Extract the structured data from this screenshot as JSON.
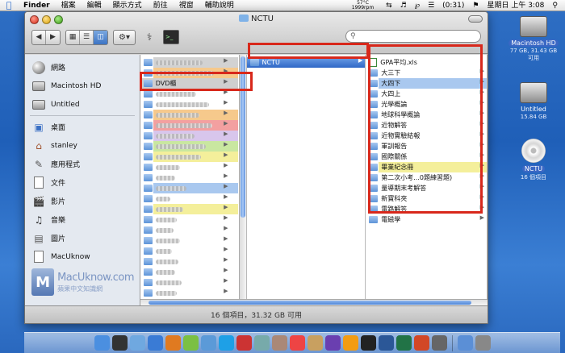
{
  "menubar": {
    "app": "Finder",
    "items": [
      "檔案",
      "編輯",
      "顯示方式",
      "前往",
      "視窗",
      "輔助說明"
    ],
    "temp": "57°C",
    "rpm": "1999rpm",
    "battery": "(0:31)",
    "clock": "星期日 上午 3:08"
  },
  "window": {
    "title": "NCTU",
    "search_placeholder": "",
    "status": "16 個項目，31.32 GB 可用"
  },
  "sidebar": {
    "devices": [
      {
        "label": "網路",
        "icon": "network-icon"
      },
      {
        "label": "Macintosh HD",
        "icon": "hard-drive-icon"
      },
      {
        "label": "Untitled",
        "icon": "drive-icon"
      }
    ],
    "places": [
      {
        "label": "桌面",
        "icon": "desktop-icon"
      },
      {
        "label": "stanley",
        "icon": "home-icon"
      },
      {
        "label": "應用程式",
        "icon": "applications-icon"
      },
      {
        "label": "文件",
        "icon": "documents-icon"
      },
      {
        "label": "影片",
        "icon": "movies-icon"
      },
      {
        "label": "音樂",
        "icon": "music-icon"
      },
      {
        "label": "圖片",
        "icon": "pictures-icon"
      },
      {
        "label": "MacUknow",
        "icon": "doc-icon"
      }
    ],
    "logo": {
      "line1": "MacUknow.com",
      "line2": "蘋果中文知識網"
    }
  },
  "column1": {
    "selected": "DVD櫃",
    "rows": [
      {
        "label": "",
        "tag": "gray",
        "arrow": true
      },
      {
        "label": "",
        "tag": "orange",
        "arrow": true
      },
      {
        "label": "DVD櫃",
        "tag": "selected",
        "arrow": true
      },
      {
        "label": "",
        "tag": "none",
        "arrow": true
      },
      {
        "label": "",
        "tag": "none",
        "arrow": true
      },
      {
        "label": "",
        "tag": "orange",
        "arrow": true
      },
      {
        "label": "",
        "tag": "red",
        "arrow": true
      },
      {
        "label": "",
        "tag": "purple",
        "arrow": true
      },
      {
        "label": "",
        "tag": "green",
        "arrow": true
      },
      {
        "label": "",
        "tag": "yellow",
        "arrow": true
      },
      {
        "label": "",
        "tag": "none",
        "arrow": true
      },
      {
        "label": "",
        "tag": "none",
        "arrow": true
      },
      {
        "label": "",
        "tag": "blue",
        "arrow": true
      },
      {
        "label": "",
        "tag": "none",
        "arrow": true
      },
      {
        "label": "",
        "tag": "yellow",
        "arrow": true
      },
      {
        "label": "",
        "tag": "none",
        "arrow": true
      },
      {
        "label": "",
        "tag": "none",
        "arrow": true
      },
      {
        "label": "",
        "tag": "none",
        "arrow": true
      },
      {
        "label": "",
        "tag": "none",
        "arrow": true
      },
      {
        "label": "",
        "tag": "none",
        "arrow": true
      },
      {
        "label": "",
        "tag": "none",
        "arrow": true
      },
      {
        "label": "",
        "tag": "none",
        "arrow": true
      },
      {
        "label": "",
        "tag": "none",
        "arrow": true
      }
    ]
  },
  "column2": {
    "rows": [
      {
        "label": "NCTU",
        "tag": "selected",
        "arrow": true
      }
    ]
  },
  "column3": {
    "rows": [
      {
        "label": "GPA平均.xls",
        "tag": "none",
        "kind": "file",
        "arrow": false
      },
      {
        "label": "大三下",
        "tag": "none",
        "kind": "folder",
        "arrow": true
      },
      {
        "label": "大四下",
        "tag": "blue",
        "kind": "folder",
        "arrow": true
      },
      {
        "label": "大四上",
        "tag": "none",
        "kind": "folder",
        "arrow": true
      },
      {
        "label": "光學概論",
        "tag": "none",
        "kind": "folder",
        "arrow": true
      },
      {
        "label": "地球科學概論",
        "tag": "none",
        "kind": "folder",
        "arrow": true
      },
      {
        "label": "近物解答",
        "tag": "none",
        "kind": "folder",
        "arrow": true
      },
      {
        "label": "近物實驗結報",
        "tag": "none",
        "kind": "folder",
        "arrow": true
      },
      {
        "label": "軍訓報告",
        "tag": "none",
        "kind": "folder",
        "arrow": true
      },
      {
        "label": "國際關係",
        "tag": "none",
        "kind": "folder",
        "arrow": true
      },
      {
        "label": "畢業紀念冊",
        "tag": "yellow",
        "kind": "folder",
        "arrow": true
      },
      {
        "label": "第二次小考...0題練習題)",
        "tag": "none",
        "kind": "folder",
        "arrow": true
      },
      {
        "label": "量導期末考解答",
        "tag": "none",
        "kind": "folder",
        "arrow": true
      },
      {
        "label": "新寶科夾",
        "tag": "none",
        "kind": "folder",
        "arrow": true
      },
      {
        "label": "電路解答",
        "tag": "none",
        "kind": "folder",
        "arrow": true
      },
      {
        "label": "電磁學",
        "tag": "none",
        "kind": "folder",
        "arrow": true
      }
    ]
  },
  "desktop": [
    {
      "label": "Macintosh HD",
      "sub": "77 GB, 31.43 GB 可用",
      "icon": "hard-drive-icon"
    },
    {
      "label": "Untitled",
      "sub": "15.84 GB",
      "icon": "drive-icon"
    },
    {
      "label": "NCTU",
      "sub": "16 個項目",
      "icon": "cd-icon"
    }
  ],
  "dock": [
    "finder-icon",
    "dashboard-icon",
    "mail-icon",
    "safari-icon",
    "firefox-icon",
    "alien-icon",
    "adium-icon",
    "skype-icon",
    "ical-icon",
    "preview-icon",
    "address-book-icon",
    "calendar-icon",
    "photo-icon",
    "itunes-icon",
    "vlc-icon",
    "terminal-icon",
    "word-icon",
    "excel-icon",
    "powerpoint-icon",
    "network-icon",
    "folder-icon",
    "trash-icon"
  ]
}
